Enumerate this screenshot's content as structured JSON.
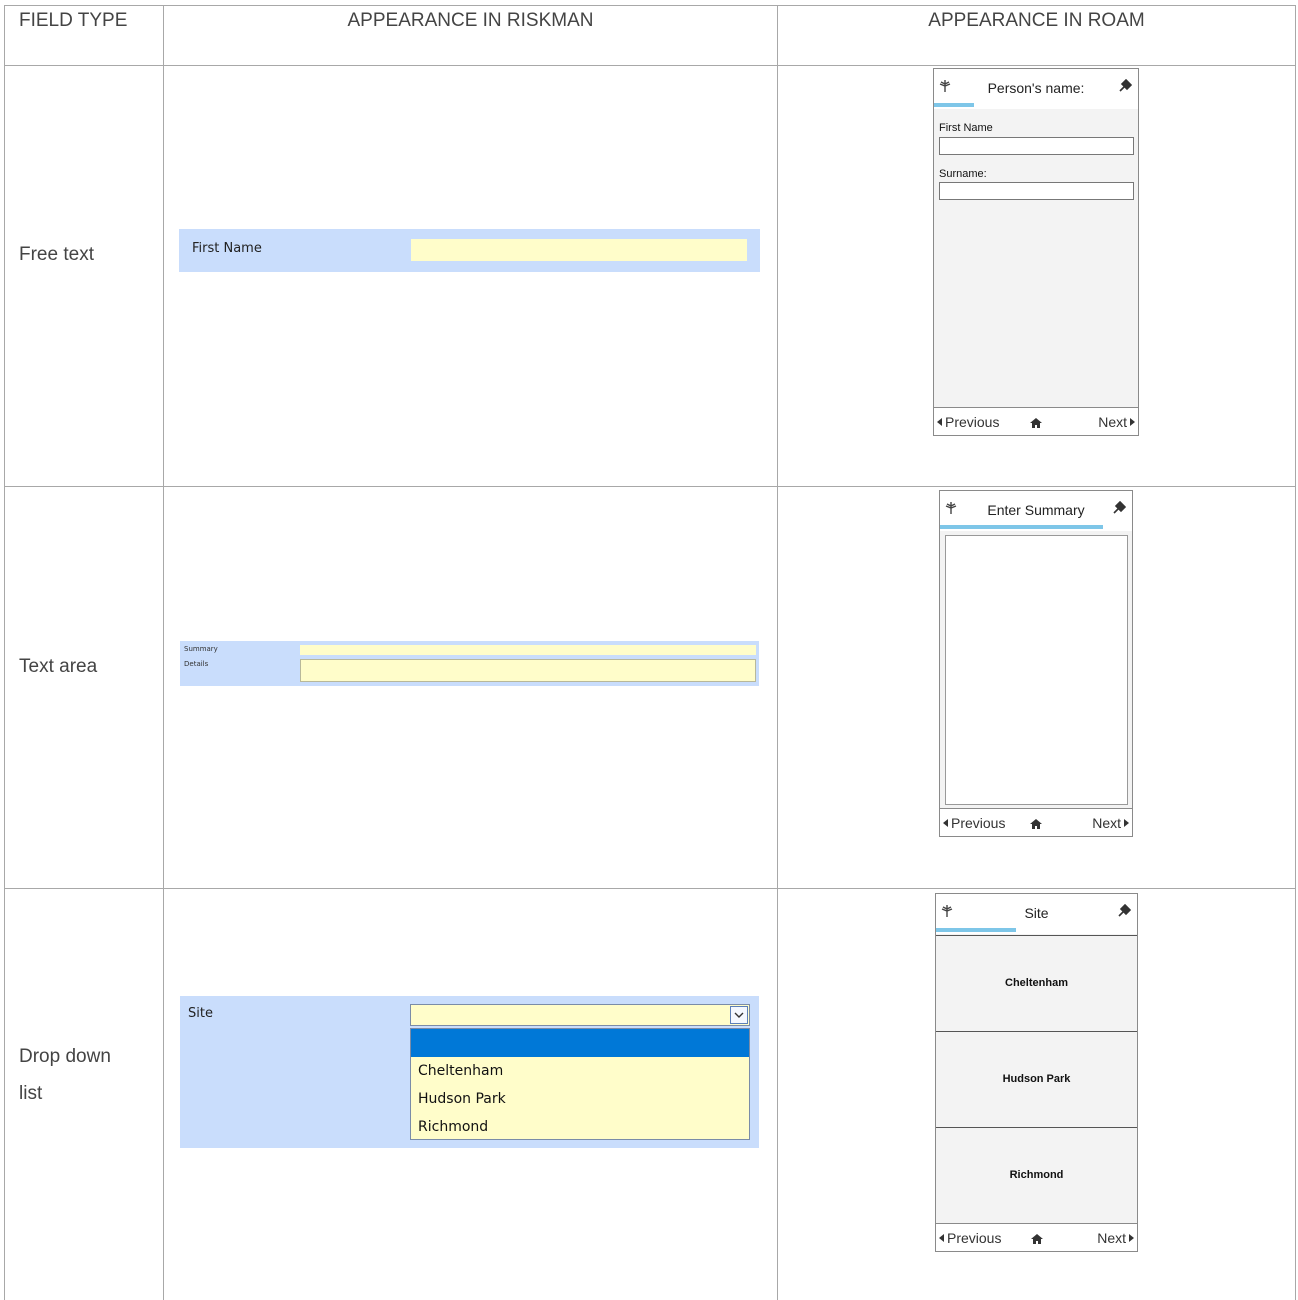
{
  "headers": {
    "field_type": "FIELD TYPE",
    "riskman": "APPEARANCE IN RISKMAN",
    "roam": "APPEARANCE IN ROAM"
  },
  "rows": {
    "free_text": {
      "type_label": "Free text",
      "riskman_label": "First Name",
      "roam": {
        "title": "Person's name:",
        "field1_label": "First Name",
        "field2_label": "Surname:",
        "progress": 0.2,
        "prev": "Previous",
        "next": "Next"
      }
    },
    "text_area": {
      "type_label": "Text area",
      "riskman_label1": "Summary",
      "riskman_label2": "Details",
      "roam": {
        "title": "Enter Summary",
        "progress": 0.85,
        "prev": "Previous",
        "next": "Next"
      }
    },
    "drop_down": {
      "type_label_line1": "Drop down",
      "type_label_line2": "list",
      "riskman_label": "Site",
      "options": [
        "Cheltenham",
        "Hudson Park",
        "Richmond"
      ],
      "roam": {
        "title": "Site",
        "progress": 0.4,
        "choices": [
          "Cheltenham",
          "Hudson Park",
          "Richmond"
        ],
        "prev": "Previous",
        "next": "Next"
      }
    }
  },
  "colors": {
    "riskman_panel": "#c9ddfc",
    "riskman_input": "#fffdca",
    "dropdown_highlight": "#0078d7",
    "roam_progress": "#7ec6e8",
    "grid_line": "#a8a8a8"
  }
}
